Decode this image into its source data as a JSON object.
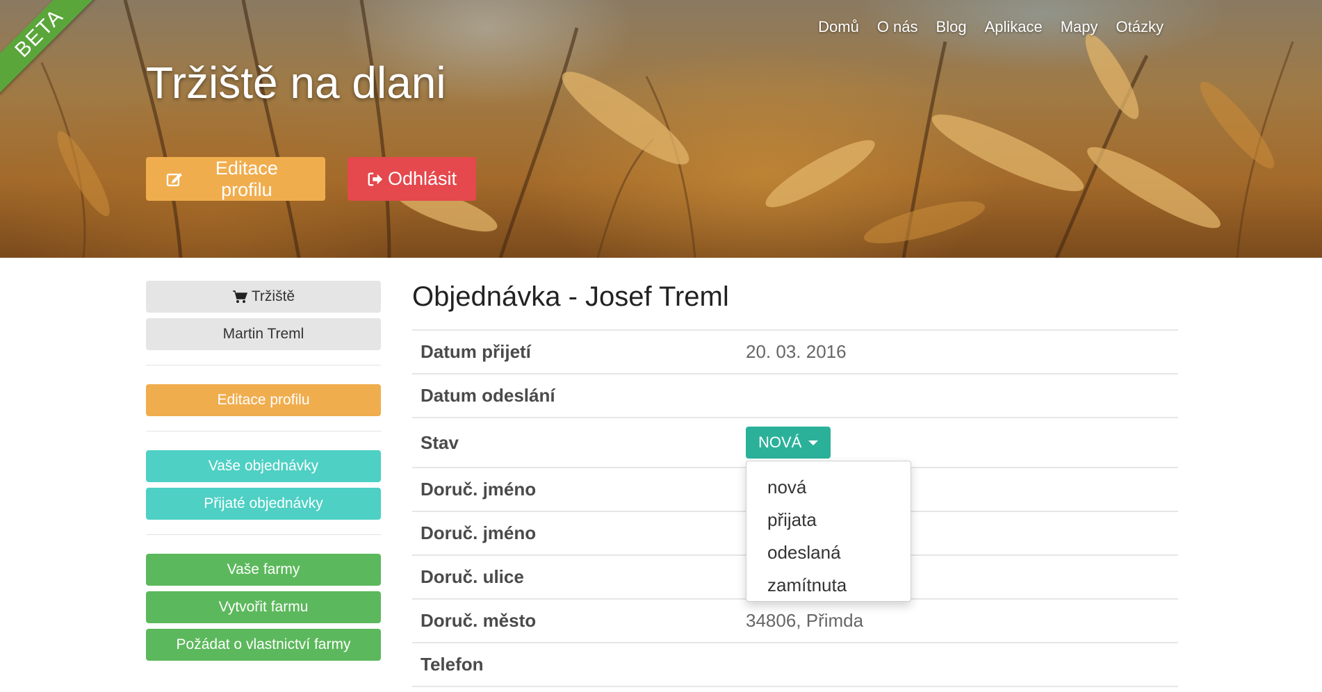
{
  "badge": {
    "beta": "BETA"
  },
  "nav": {
    "items": [
      {
        "label": "Domů"
      },
      {
        "label": "O nás"
      },
      {
        "label": "Blog"
      },
      {
        "label": "Aplikace"
      },
      {
        "label": "Mapy"
      },
      {
        "label": "Otázky"
      }
    ]
  },
  "hero": {
    "title": "Tržiště na dlani",
    "edit_label": "Editace profilu",
    "logout_label": "Odhlásit"
  },
  "sidebar": {
    "market_label": "Tržiště",
    "user_name": "Martin Treml",
    "edit_profile": "Editace profilu",
    "your_orders": "Vaše objednávky",
    "received_orders": "Přijaté objednávky",
    "your_farms": "Vaše farmy",
    "create_farm": "Vytvořit farmu",
    "request_farm": "Požádat o vlastnictví farmy"
  },
  "order": {
    "title": "Objednávka - Josef Treml",
    "rows": [
      {
        "label": "Datum přijetí",
        "value": "20. 03. 2016"
      },
      {
        "label": "Datum odeslání",
        "value": ""
      },
      {
        "label": "Stav",
        "value": ""
      },
      {
        "label": "Doruč. jméno",
        "value": ""
      },
      {
        "label": "Doruč. jméno",
        "value": ""
      },
      {
        "label": "Doruč. ulice",
        "value": ""
      },
      {
        "label": "Doruč. město",
        "value": "34806, Přimda"
      },
      {
        "label": "Telefon",
        "value": ""
      }
    ],
    "status_selected": "NOVÁ",
    "status_options": [
      "nová",
      "přijata",
      "odeslaná",
      "zamítnuta"
    ]
  },
  "colors": {
    "orange": "#f0ad4e",
    "red": "#e5484d",
    "teal": "#4ed0c4",
    "green": "#5cb85c",
    "status": "#2bb19a"
  }
}
